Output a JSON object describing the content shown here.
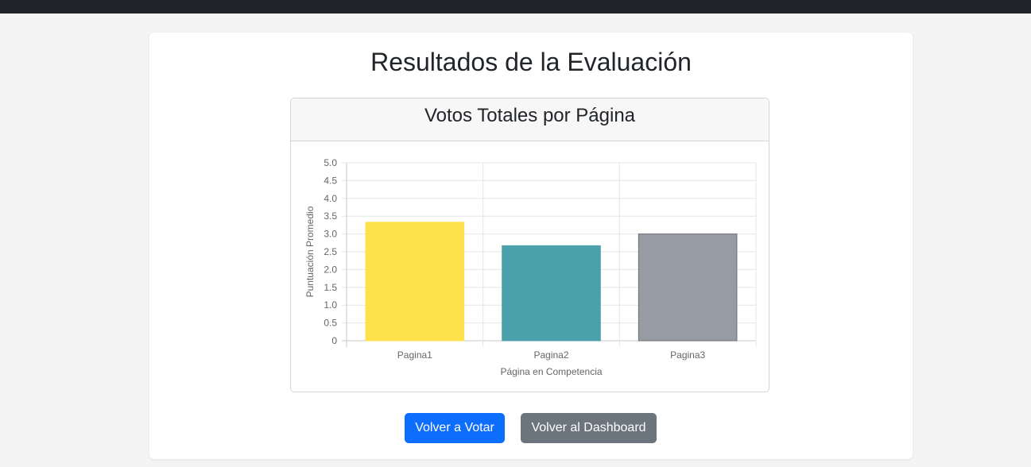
{
  "page": {
    "title": "Resultados de la Evaluación"
  },
  "chart_card": {
    "title": "Votos Totales por Página"
  },
  "buttons": {
    "vote_again": "Volver a Votar",
    "dashboard": "Volver al Dashboard"
  },
  "chart_data": {
    "type": "bar",
    "categories": [
      "Pagina1",
      "Pagina2",
      "Pagina3"
    ],
    "values": [
      3.33,
      2.67,
      3.0
    ],
    "xlabel": "Página en Competencia",
    "ylabel": "Puntuación Promedio",
    "ylim": [
      0,
      5
    ],
    "yticks": [
      0,
      0.5,
      1.0,
      1.5,
      2.0,
      2.5,
      3.0,
      3.5,
      4.0,
      4.5,
      5.0
    ],
    "ytick_labels": [
      "0",
      "0.5",
      "1.0",
      "1.5",
      "2.0",
      "2.5",
      "3.0",
      "3.5",
      "4.0",
      "4.5",
      "5.0"
    ],
    "colors": [
      "#ffe14c",
      "#4ca0ab",
      "#979ca4"
    ],
    "border_colors": [
      "#ffe14c",
      "#4ca0ab",
      "#6b6f74"
    ],
    "grid": true,
    "legend": "none"
  }
}
